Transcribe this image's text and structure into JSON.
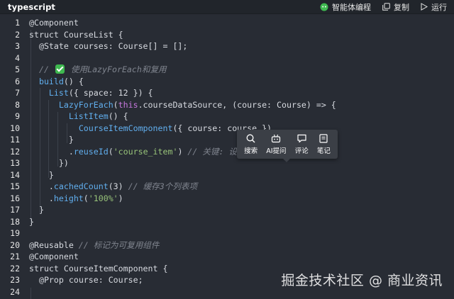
{
  "header": {
    "language": "typescript",
    "actions": [
      {
        "label": "智能体编程",
        "icon": "agent-icon"
      },
      {
        "label": "复制",
        "icon": "copy-icon"
      },
      {
        "label": "运行",
        "icon": "play-icon"
      }
    ]
  },
  "code": {
    "line_numbers": [
      "1",
      "2",
      "3",
      "4",
      "5",
      "6",
      "7",
      "8",
      "9",
      "10",
      "11",
      "12",
      "13",
      "14",
      "15",
      "16",
      "17",
      "18",
      "19",
      "20",
      "21",
      "22",
      "23",
      "24"
    ],
    "l1": {
      "deco": "@Component"
    },
    "l2": {
      "kw": "struct",
      "name": " CourseList {"
    },
    "l3": {
      "deco": "@State",
      "rest": " courses: Course[] = [];"
    },
    "l5": {
      "cmt_a": "// ",
      "cmt_b": " 使用LazyForEach和复用"
    },
    "l6": {
      "fn": "build",
      "rest": "() {"
    },
    "l7": {
      "fn": "List",
      "a": "({ space: ",
      "num": "12",
      "b": " }) {"
    },
    "l8": {
      "fn": "LazyForEach",
      "a": "(",
      "this": "this",
      "b": ".courseDataSource, (course: Course) => {"
    },
    "l9": {
      "fn": "ListItem",
      "rest": "() {"
    },
    "l10": {
      "fn": "CourseItemComponent",
      "rest": "({ course: course })"
    },
    "l11": {
      "rest": "}"
    },
    "l12": {
      "dot": ".",
      "fn": "reuseId",
      "a": "(",
      "str": "'course_item'",
      "b": ") ",
      "cmt": "// 关键: 设置复用"
    },
    "l13": {
      "rest": "})"
    },
    "l14": {
      "rest": "}"
    },
    "l15": {
      "dot": ".",
      "fn": "cachedCount",
      "a": "(",
      "num": "3",
      "b": ") ",
      "cmt": "// 缓存3个列表项"
    },
    "l16": {
      "dot": ".",
      "fn": "height",
      "a": "(",
      "str": "'100%'",
      "b": ")"
    },
    "l17": {
      "rest": "}"
    },
    "l18": {
      "rest": "}"
    },
    "l20": {
      "deco": "@Reusable",
      "cmt": " // 标记为可复用组件"
    },
    "l21": {
      "deco": "@Component"
    },
    "l22": {
      "kw": "struct",
      "name": " CourseItemComponent {"
    },
    "l23": {
      "deco": "@Prop",
      "rest": " course: Course;"
    }
  },
  "popup": {
    "items": [
      {
        "label": "搜索",
        "icon": "search-icon"
      },
      {
        "label": "AI提问",
        "icon": "ai-robot-icon"
      },
      {
        "label": "评论",
        "icon": "comment-icon"
      },
      {
        "label": "笔记",
        "icon": "note-icon"
      }
    ]
  },
  "watermark": "掘金技术社区 @ 商业资讯"
}
